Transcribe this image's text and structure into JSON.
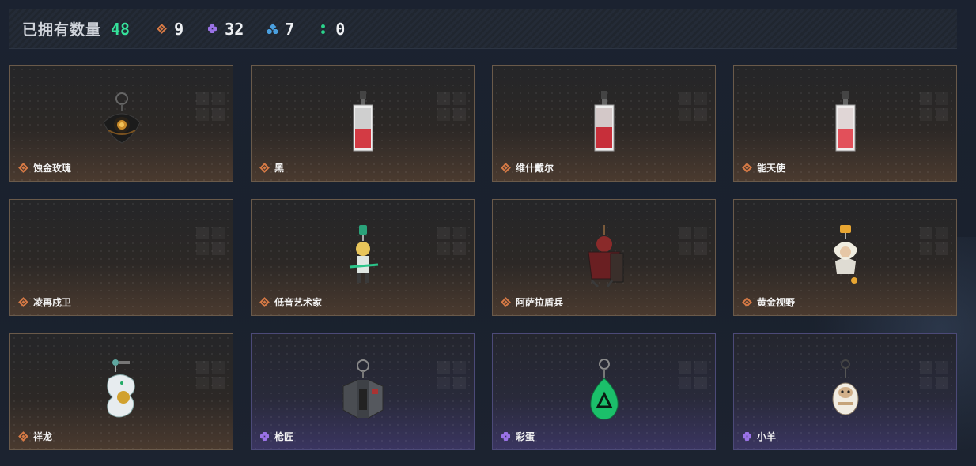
{
  "header": {
    "owned_label": "已拥有数量",
    "owned_count": "48",
    "stats": [
      {
        "icon": "orange-diamond-icon",
        "value": "9",
        "color": "#d77a45"
      },
      {
        "icon": "purple-diamond-icon",
        "value": "32",
        "color": "#9a72e6"
      },
      {
        "icon": "blue-diamond-icon",
        "value": "7",
        "color": "#4aa0e0"
      },
      {
        "icon": "green-dots-icon",
        "value": "0",
        "color": "#2bd38c"
      }
    ]
  },
  "cards": [
    {
      "name": "蚀金玫瑰",
      "rarity": "orange",
      "art": "black-gold-rose-charm"
    },
    {
      "name": "黑",
      "rarity": "orange",
      "art": "card-charm"
    },
    {
      "name": "维什戴尔",
      "rarity": "orange",
      "art": "card-charm"
    },
    {
      "name": "能天使",
      "rarity": "orange",
      "art": "card-charm"
    },
    {
      "name": "凌再戍卫",
      "rarity": "orange",
      "art": "none"
    },
    {
      "name": "低音艺术家",
      "rarity": "orange",
      "art": "figure-charm"
    },
    {
      "name": "阿萨拉盾兵",
      "rarity": "orange",
      "art": "shield-soldier-charm"
    },
    {
      "name": "黄金视野",
      "rarity": "orange",
      "art": "figure-charm"
    },
    {
      "name": "祥龙",
      "rarity": "orange",
      "art": "dragon-charm"
    },
    {
      "name": "枪匠",
      "rarity": "purple",
      "art": "gunsmith-charm"
    },
    {
      "name": "彩蛋",
      "rarity": "purple",
      "art": "egg-charm"
    },
    {
      "name": "小羊",
      "rarity": "purple",
      "art": "lamb-charm"
    }
  ]
}
